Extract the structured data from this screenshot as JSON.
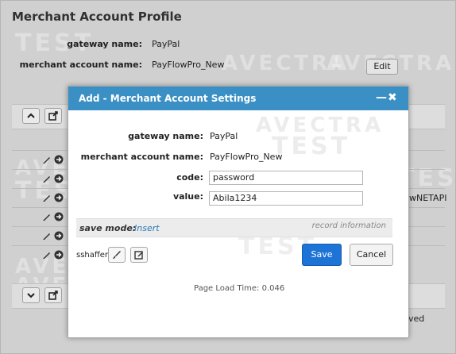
{
  "page": {
    "title": "Merchant Account Profile",
    "gateway_label": "gateway name:",
    "gateway_value": "PayPal",
    "merchant_label": "merchant account name:",
    "merchant_value": "PayFlowPro_New",
    "edit_button": "Edit",
    "partial_text_right": "wNETAPI",
    "partial_text_bottom": "ved",
    "watermarks": [
      "AVECTRA",
      "TEST",
      "AVECTRA",
      "TEST",
      "AVECTRA",
      "TEST"
    ]
  },
  "dialog": {
    "title": "Add - Merchant Account Settings",
    "fields": {
      "gateway_label": "gateway name:",
      "gateway_value": "PayPal",
      "merchant_label": "merchant account name:",
      "merchant_value": "PayFlowPro_New",
      "code_label": "code:",
      "code_value": "password",
      "value_label": "value:",
      "value_value": "Abila1234"
    },
    "save_mode_label": "save mode:",
    "save_mode_value": "Insert",
    "record_info": "record information",
    "user": "sshaffer",
    "save_button": "Save",
    "cancel_button": "Cancel",
    "page_load": "Page Load Time: 0.046"
  },
  "colors": {
    "header_blue": "#3a8fc4",
    "save_blue": "#1e74d6",
    "link_blue": "#2a7ab5"
  }
}
